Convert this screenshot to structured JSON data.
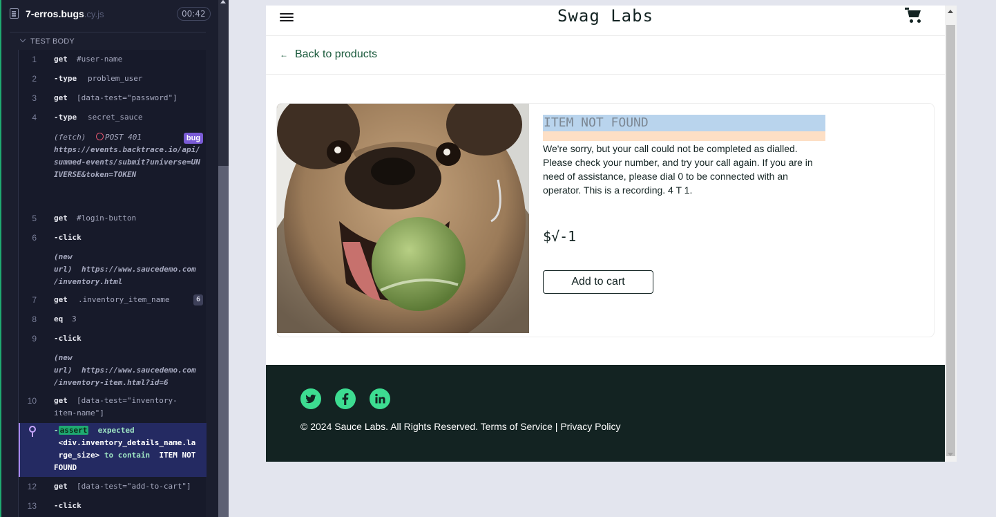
{
  "reporter": {
    "spec_name": "7-erros.bugs",
    "spec_ext": ".cy.js",
    "duration": "00:42",
    "section_label": "TEST BODY",
    "commands": [
      {
        "num": "1",
        "name": "get",
        "arg": "#user-name"
      },
      {
        "num": "2",
        "name": "-type",
        "arg": "problem_user"
      },
      {
        "num": "3",
        "name": "get",
        "arg": "[data-test=\"password\"]"
      },
      {
        "num": "4",
        "name": "-type",
        "arg": "secret_sauce"
      },
      {
        "num": "5",
        "name": "get",
        "arg": "#login-button"
      },
      {
        "num": "6",
        "name": "-click",
        "arg": ""
      },
      {
        "num": "7",
        "name": "get",
        "arg": ".inventory_item_name",
        "badge": "6"
      },
      {
        "num": "8",
        "name": "eq",
        "arg": "3"
      },
      {
        "num": "9",
        "name": "-click",
        "arg": ""
      },
      {
        "num": "10",
        "name": "get",
        "arg": "[data-test=\"inventory-",
        "arg2": "item-name\"]"
      },
      {
        "num": "12",
        "name": "get",
        "arg": "[data-test=\"add-to-cart\"]"
      },
      {
        "num": "13",
        "name": "-click",
        "arg": ""
      }
    ],
    "fetch": {
      "label": "(fetch)",
      "status": "POST 401",
      "url": "https://events.backtrace.io/api/summed-events/submit?universe=UNIVERSE&token=TOKEN",
      "badge": "bug"
    },
    "new_url_1": {
      "label_a": "(new",
      "label_b": "url)",
      "url_a": "https://www.saucedemo.com",
      "url_b": "/inventory.html"
    },
    "new_url_2": {
      "label_a": "(new",
      "label_b": "url)",
      "url_a": "https://www.saucedemo.com",
      "url_b": "/inventory-item.html?id=6"
    },
    "assert": {
      "dash": "-",
      "keyword": "assert",
      "text_1": "expected",
      "selector_a": "<div.inventory_details_name.la",
      "selector_b": "rge_size>",
      "text_2": "to contain",
      "value_a": "ITEM NOT",
      "value_b": "FOUND"
    }
  },
  "app": {
    "logo": "Swag Labs",
    "back_link": "Back to products",
    "product": {
      "title": "ITEM NOT FOUND",
      "description": "We're sorry, but your call could not be completed as dialled. Please check your number, and try your call again. If you are in need of assistance, please dial 0 to be connected with an operator. This is a recording. 4 T 1.",
      "price": "$√-1",
      "add_to_cart": "Add to cart"
    },
    "footer": {
      "copyright": "© 2024 Sauce Labs. All Rights Reserved. Terms of Service | Privacy Policy",
      "social": [
        "twitter-icon",
        "facebook-icon",
        "linkedin-icon"
      ],
      "accent_color": "#3ddc91"
    }
  },
  "colors": {
    "reporter_bg": "#1b1e2e",
    "active_command_bg": "#242a62",
    "footer_bg": "#132322",
    "title_highlight": "#b9d4ed"
  }
}
